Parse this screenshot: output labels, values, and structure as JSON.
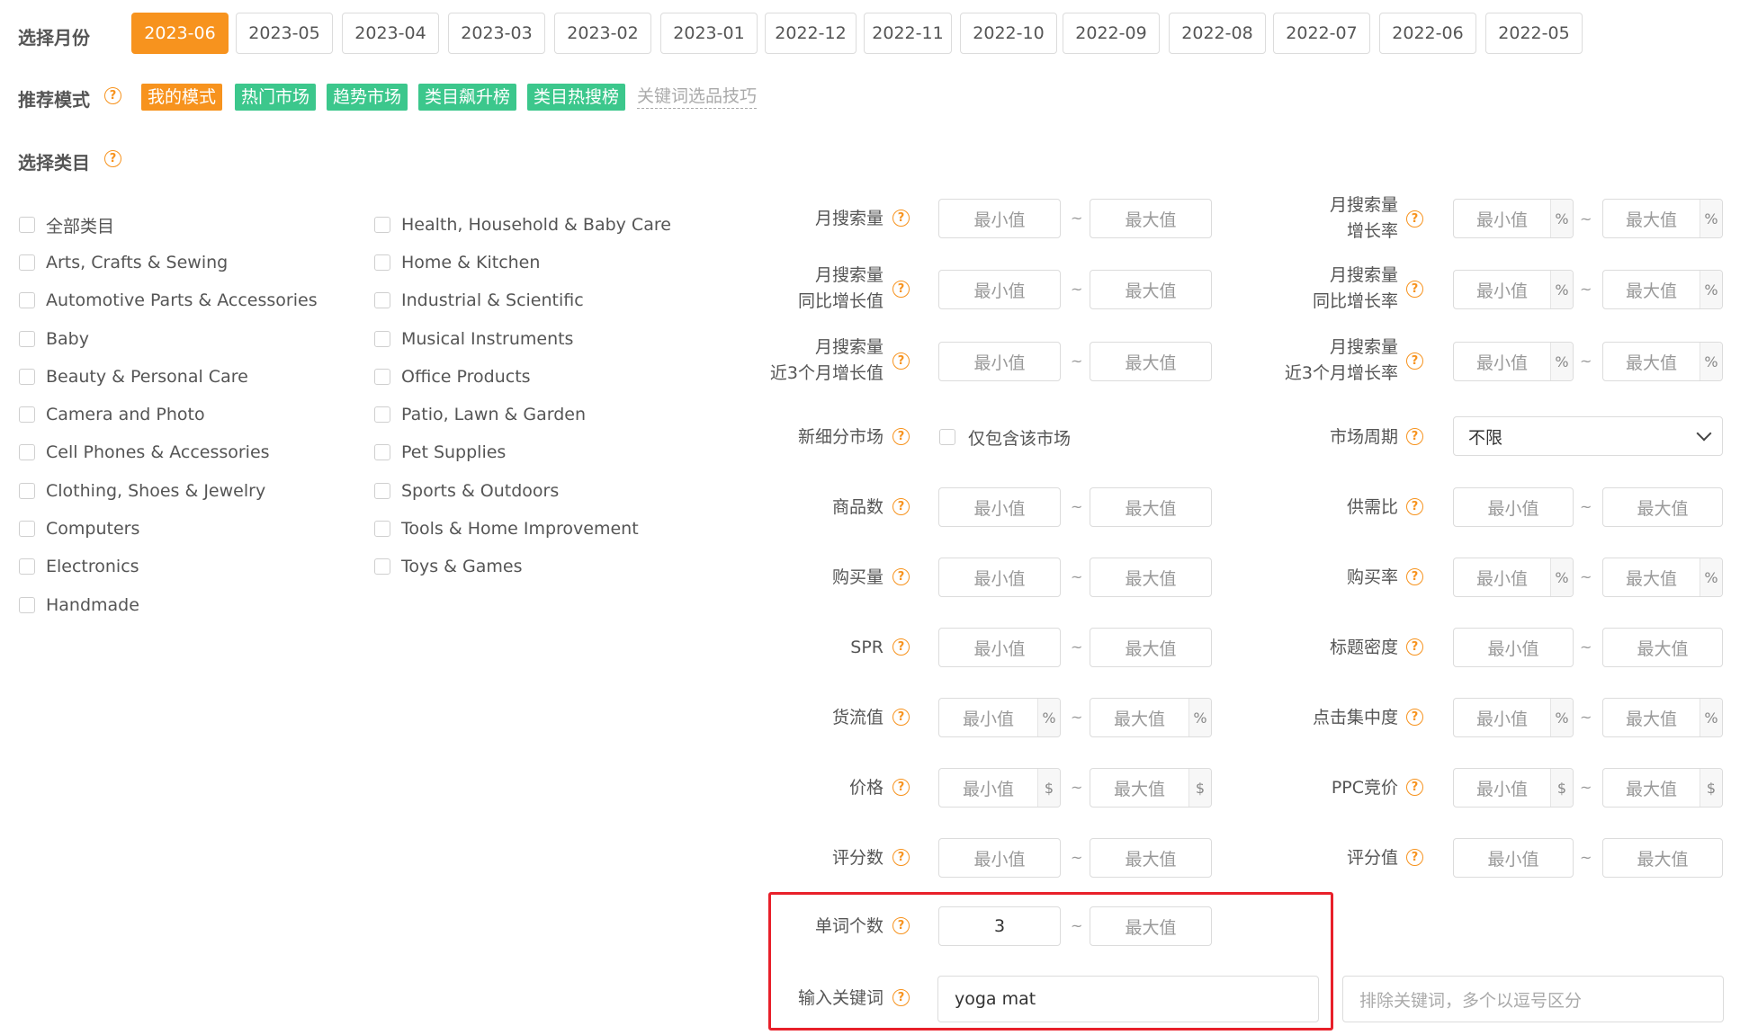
{
  "month_section": {
    "label": "选择月份",
    "months": [
      "2023-06",
      "2023-05",
      "2023-04",
      "2023-03",
      "2023-02",
      "2023-01",
      "2022-12",
      "2022-11",
      "2022-10",
      "2022-09",
      "2022-08",
      "2022-07",
      "2022-06",
      "2022-05"
    ],
    "selected": "2023-06"
  },
  "mode_section": {
    "label": "推荐模式",
    "help": "?",
    "tags": [
      {
        "label": "我的模式",
        "color": "#f7931e"
      },
      {
        "label": "热门市场",
        "color": "#3cc78c"
      },
      {
        "label": "趋势市场",
        "color": "#3cc78c"
      },
      {
        "label": "类目飙升榜",
        "color": "#3cc78c"
      },
      {
        "label": "类目热搜榜",
        "color": "#3cc78c"
      }
    ],
    "tip_link": "关键词选品技巧"
  },
  "category_section": {
    "label": "选择类目",
    "help": "?",
    "col1": [
      "全部类目",
      "Arts, Crafts & Sewing",
      "Automotive Parts & Accessories",
      "Baby",
      "Beauty & Personal Care",
      "Camera and Photo",
      "Cell Phones & Accessories",
      "Clothing, Shoes & Jewelry",
      "Computers",
      "Electronics",
      "Handmade"
    ],
    "col2": [
      "Health, Household & Baby Care",
      "Home & Kitchen",
      "Industrial & Scientific",
      "Musical Instruments",
      "Office Products",
      "Patio, Lawn & Garden",
      "Pet Supplies",
      "Sports & Outdoors",
      "Tools & Home Improvement",
      "Toys & Games"
    ]
  },
  "filters": {
    "min_ph": "最小值",
    "max_ph": "最大值",
    "tilde": "~",
    "help": "?",
    "percent": "%",
    "dollar": "$",
    "left": [
      {
        "l1": "月搜索量",
        "l2": ""
      },
      {
        "l1": "月搜索量",
        "l2": "同比增长值"
      },
      {
        "l1": "月搜索量",
        "l2": "近3个月增长值"
      },
      {
        "l1": "新细分市场",
        "l2": ""
      },
      {
        "l1": "商品数",
        "l2": ""
      },
      {
        "l1": "购买量",
        "l2": ""
      },
      {
        "l1": "SPR",
        "l2": ""
      },
      {
        "l1": "货流值",
        "l2": ""
      },
      {
        "l1": "价格",
        "l2": ""
      },
      {
        "l1": "评分数",
        "l2": ""
      },
      {
        "l1": "单词个数",
        "l2": ""
      },
      {
        "l1": "输入关键词",
        "l2": ""
      }
    ],
    "right": [
      {
        "l1": "月搜索量",
        "l2": "增长率"
      },
      {
        "l1": "月搜索量",
        "l2": "同比增长率"
      },
      {
        "l1": "月搜索量",
        "l2": "近3个月增长率"
      },
      {
        "l1": "市场周期",
        "l2": ""
      },
      {
        "l1": "供需比",
        "l2": ""
      },
      {
        "l1": "购买率",
        "l2": ""
      },
      {
        "l1": "标题密度",
        "l2": ""
      },
      {
        "l1": "点击集中度",
        "l2": ""
      },
      {
        "l1": "PPC竞价",
        "l2": ""
      },
      {
        "l1": "评分值",
        "l2": ""
      }
    ],
    "new_market_checkbox": "仅包含该市场",
    "market_cycle_value": "不限",
    "word_count_min": "3",
    "keyword_value": "yoga mat",
    "exclude_placeholder": "排除关键词，多个以逗号区分"
  },
  "colors": {
    "accent": "#f7931e",
    "green": "#3cc78c",
    "highlight": "#e8202a"
  }
}
